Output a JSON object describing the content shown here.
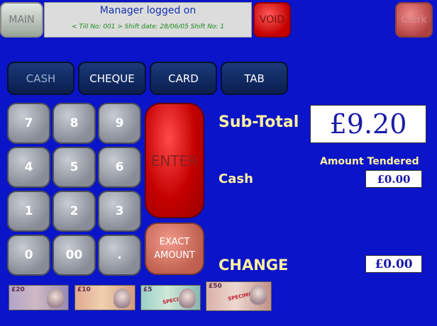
{
  "header": {
    "main_label": "MAIN",
    "void_label": "VOID",
    "clerk_label": "Clerk",
    "status_title": "Manager logged on",
    "status_info": "< Till No: 001 >  Shift date: 28/06/05  Shift No: 1"
  },
  "tenders": [
    "CASH",
    "CHEQUE",
    "CARD",
    "TAB"
  ],
  "keypad": {
    "keys": [
      "7",
      "8",
      "9",
      "4",
      "5",
      "6",
      "1",
      "2",
      "3",
      "0",
      "00",
      "."
    ],
    "enter_label": "ENTER",
    "exact_label_line1": "EXACT",
    "exact_label_line2": "AMOUNT"
  },
  "totals": {
    "subtotal_label": "Sub-Total",
    "subtotal_value": "£9.20",
    "amount_tendered_label": "Amount Tendered",
    "cash_label": "Cash",
    "cash_value": "£0.00",
    "change_label": "CHANGE",
    "change_value": "£0.00"
  },
  "notes": [
    {
      "value": "£20",
      "stamp": ""
    },
    {
      "value": "£10",
      "stamp": ""
    },
    {
      "value": "£5",
      "stamp": "SPECIMEN"
    },
    {
      "value": "£50",
      "stamp": "SPECIMEN"
    }
  ],
  "colors": {
    "background": "#0a14c8",
    "accent_yellow": "#fff0a0",
    "void_red": "#c40000"
  }
}
